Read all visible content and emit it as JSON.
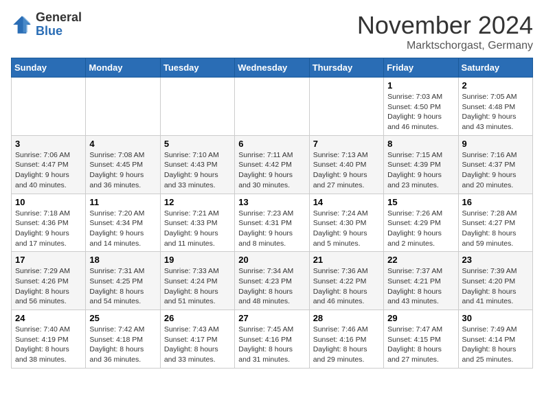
{
  "logo": {
    "general": "General",
    "blue": "Blue"
  },
  "title": "November 2024",
  "location": "Marktschorgast, Germany",
  "weekdays": [
    "Sunday",
    "Monday",
    "Tuesday",
    "Wednesday",
    "Thursday",
    "Friday",
    "Saturday"
  ],
  "weeks": [
    [
      {
        "day": null
      },
      {
        "day": null
      },
      {
        "day": null
      },
      {
        "day": null
      },
      {
        "day": null
      },
      {
        "day": "1",
        "sunrise": "7:03 AM",
        "sunset": "4:50 PM",
        "daylight": "9 hours and 46 minutes."
      },
      {
        "day": "2",
        "sunrise": "7:05 AM",
        "sunset": "4:48 PM",
        "daylight": "9 hours and 43 minutes."
      }
    ],
    [
      {
        "day": "3",
        "sunrise": "7:06 AM",
        "sunset": "4:47 PM",
        "daylight": "9 hours and 40 minutes."
      },
      {
        "day": "4",
        "sunrise": "7:08 AM",
        "sunset": "4:45 PM",
        "daylight": "9 hours and 36 minutes."
      },
      {
        "day": "5",
        "sunrise": "7:10 AM",
        "sunset": "4:43 PM",
        "daylight": "9 hours and 33 minutes."
      },
      {
        "day": "6",
        "sunrise": "7:11 AM",
        "sunset": "4:42 PM",
        "daylight": "9 hours and 30 minutes."
      },
      {
        "day": "7",
        "sunrise": "7:13 AM",
        "sunset": "4:40 PM",
        "daylight": "9 hours and 27 minutes."
      },
      {
        "day": "8",
        "sunrise": "7:15 AM",
        "sunset": "4:39 PM",
        "daylight": "9 hours and 23 minutes."
      },
      {
        "day": "9",
        "sunrise": "7:16 AM",
        "sunset": "4:37 PM",
        "daylight": "9 hours and 20 minutes."
      }
    ],
    [
      {
        "day": "10",
        "sunrise": "7:18 AM",
        "sunset": "4:36 PM",
        "daylight": "9 hours and 17 minutes."
      },
      {
        "day": "11",
        "sunrise": "7:20 AM",
        "sunset": "4:34 PM",
        "daylight": "9 hours and 14 minutes."
      },
      {
        "day": "12",
        "sunrise": "7:21 AM",
        "sunset": "4:33 PM",
        "daylight": "9 hours and 11 minutes."
      },
      {
        "day": "13",
        "sunrise": "7:23 AM",
        "sunset": "4:31 PM",
        "daylight": "9 hours and 8 minutes."
      },
      {
        "day": "14",
        "sunrise": "7:24 AM",
        "sunset": "4:30 PM",
        "daylight": "9 hours and 5 minutes."
      },
      {
        "day": "15",
        "sunrise": "7:26 AM",
        "sunset": "4:29 PM",
        "daylight": "9 hours and 2 minutes."
      },
      {
        "day": "16",
        "sunrise": "7:28 AM",
        "sunset": "4:27 PM",
        "daylight": "8 hours and 59 minutes."
      }
    ],
    [
      {
        "day": "17",
        "sunrise": "7:29 AM",
        "sunset": "4:26 PM",
        "daylight": "8 hours and 56 minutes."
      },
      {
        "day": "18",
        "sunrise": "7:31 AM",
        "sunset": "4:25 PM",
        "daylight": "8 hours and 54 minutes."
      },
      {
        "day": "19",
        "sunrise": "7:33 AM",
        "sunset": "4:24 PM",
        "daylight": "8 hours and 51 minutes."
      },
      {
        "day": "20",
        "sunrise": "7:34 AM",
        "sunset": "4:23 PM",
        "daylight": "8 hours and 48 minutes."
      },
      {
        "day": "21",
        "sunrise": "7:36 AM",
        "sunset": "4:22 PM",
        "daylight": "8 hours and 46 minutes."
      },
      {
        "day": "22",
        "sunrise": "7:37 AM",
        "sunset": "4:21 PM",
        "daylight": "8 hours and 43 minutes."
      },
      {
        "day": "23",
        "sunrise": "7:39 AM",
        "sunset": "4:20 PM",
        "daylight": "8 hours and 41 minutes."
      }
    ],
    [
      {
        "day": "24",
        "sunrise": "7:40 AM",
        "sunset": "4:19 PM",
        "daylight": "8 hours and 38 minutes."
      },
      {
        "day": "25",
        "sunrise": "7:42 AM",
        "sunset": "4:18 PM",
        "daylight": "8 hours and 36 minutes."
      },
      {
        "day": "26",
        "sunrise": "7:43 AM",
        "sunset": "4:17 PM",
        "daylight": "8 hours and 33 minutes."
      },
      {
        "day": "27",
        "sunrise": "7:45 AM",
        "sunset": "4:16 PM",
        "daylight": "8 hours and 31 minutes."
      },
      {
        "day": "28",
        "sunrise": "7:46 AM",
        "sunset": "4:16 PM",
        "daylight": "8 hours and 29 minutes."
      },
      {
        "day": "29",
        "sunrise": "7:47 AM",
        "sunset": "4:15 PM",
        "daylight": "8 hours and 27 minutes."
      },
      {
        "day": "30",
        "sunrise": "7:49 AM",
        "sunset": "4:14 PM",
        "daylight": "8 hours and 25 minutes."
      }
    ]
  ],
  "labels": {
    "sunrise": "Sunrise:",
    "sunset": "Sunset:",
    "daylight": "Daylight:"
  }
}
